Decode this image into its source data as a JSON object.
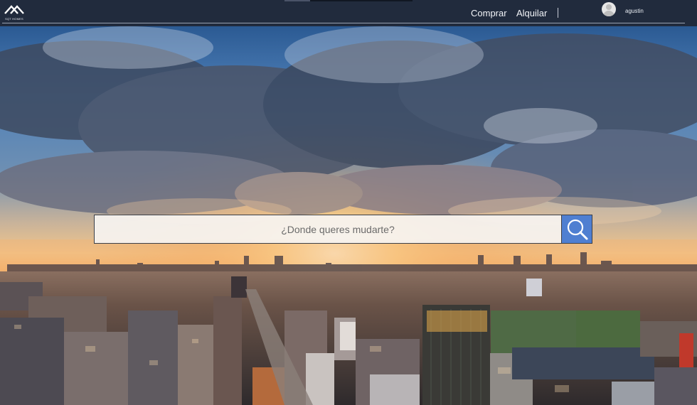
{
  "brand": {
    "logo_text": "SQT HOMES"
  },
  "nav": {
    "buy_label": "Comprar",
    "rent_label": "Alquilar",
    "username": "agustin"
  },
  "search": {
    "placeholder": "¿Donde queres mudarte?"
  },
  "colors": {
    "navbar_bg": "#212b3d",
    "search_button": "#4f7fd1"
  },
  "icons": {
    "logo": "house-roof-logo-icon",
    "user": "user-avatar-icon",
    "search": "magnifier-icon"
  }
}
